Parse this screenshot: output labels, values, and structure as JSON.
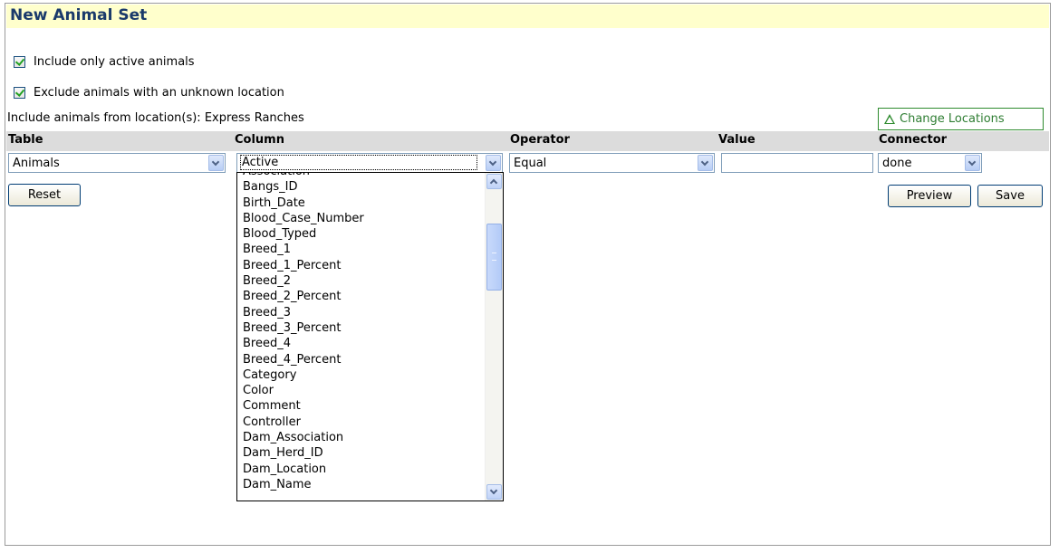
{
  "title": "New Animal Set",
  "options": {
    "active_only_label": "Include only active animals",
    "active_only_checked": true,
    "exclude_unknown_label": "Exclude animals with an unknown location",
    "exclude_unknown_checked": true
  },
  "location_info": "Include animals from location(s): Express Ranches",
  "change_locations_label": "Change Locations",
  "columns": {
    "table": "Table",
    "column": "Column",
    "operator": "Operator",
    "value": "Value",
    "connector": "Connector"
  },
  "row": {
    "table_value": "Animals",
    "column_value": "Active",
    "operator_value": "Equal",
    "value_value": "",
    "connector_value": "done"
  },
  "buttons": {
    "reset": "Reset",
    "preview": "Preview",
    "save": "Save"
  },
  "dropdown_items": [
    "Association",
    "Bangs_ID",
    "Birth_Date",
    "Blood_Case_Number",
    "Blood_Typed",
    "Breed_1",
    "Breed_1_Percent",
    "Breed_2",
    "Breed_2_Percent",
    "Breed_3",
    "Breed_3_Percent",
    "Breed_4",
    "Breed_4_Percent",
    "Category",
    "Color",
    "Comment",
    "Controller",
    "Dam_Association",
    "Dam_Herd_ID",
    "Dam_Location",
    "Dam_Name"
  ],
  "icons": {
    "change_locations": "warning-triangle-icon",
    "dropdown_arrow": "chevron-down-icon",
    "checkbox": "checkmark-icon"
  },
  "colors": {
    "title_bg": "#ffffcc",
    "title_text": "#1a3a6b",
    "header_bg": "#dcdcdc",
    "accent_green": "#2e8b2e"
  }
}
